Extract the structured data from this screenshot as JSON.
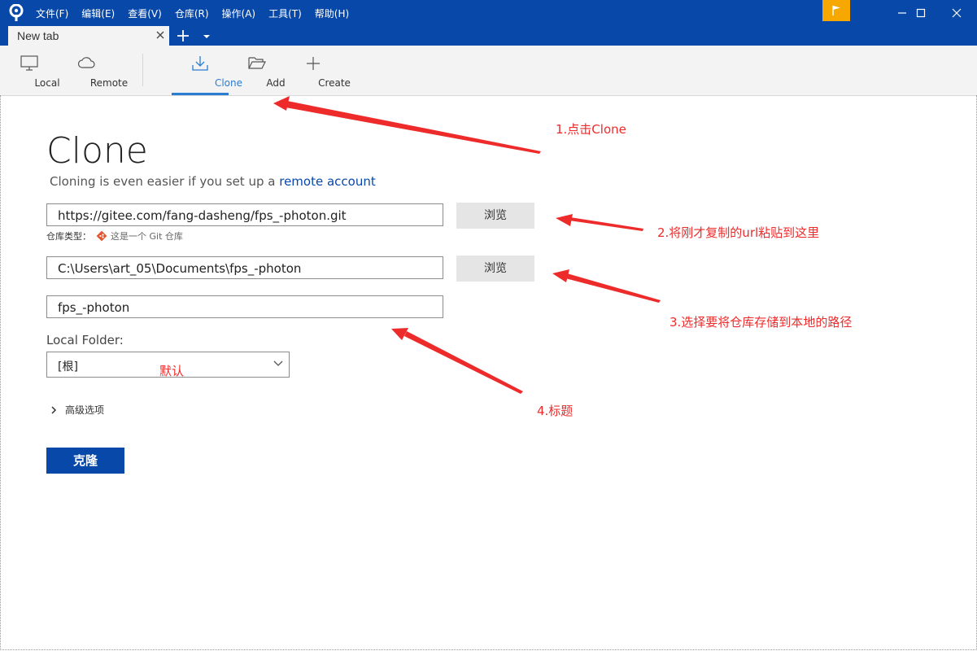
{
  "menu": [
    "文件(F)",
    "编辑(E)",
    "查看(V)",
    "仓库(R)",
    "操作(A)",
    "工具(T)",
    "帮助(H)"
  ],
  "tab": {
    "label": "New tab"
  },
  "toolbar": {
    "local": "Local",
    "remote": "Remote",
    "clone": "Clone",
    "add": "Add",
    "create": "Create"
  },
  "page": {
    "title": "Clone",
    "subtitle_prefix": "Cloning is even easier if you set up a",
    "subtitle_link": "remote account"
  },
  "form": {
    "source_url": "https://gitee.com/fang-dasheng/fps_-photon.git",
    "browse_label": "浏览",
    "repo_type_label": "仓库类型：",
    "repo_type_value": "这是一个 Git 仓库",
    "dest_path": "C:\\Users\\art_05\\Documents\\fps_-photon",
    "name": "fps_-photon",
    "local_folder_label": "Local Folder:",
    "local_folder_value": "[根]",
    "advanced_label": "高级选项",
    "clone_button": "克隆"
  },
  "annotations": {
    "a1": "1.点击Clone",
    "a2": "2.将刚才复制的url粘贴到这里",
    "a3": "3.选择要将仓库存储到本地的路径",
    "a4": "4.标题",
    "default": "默认"
  },
  "colors": {
    "titlebar": "#0848a8",
    "accent": "#2a7dd1",
    "flag": "#f6a800",
    "annotation": "#ee2b2b"
  }
}
